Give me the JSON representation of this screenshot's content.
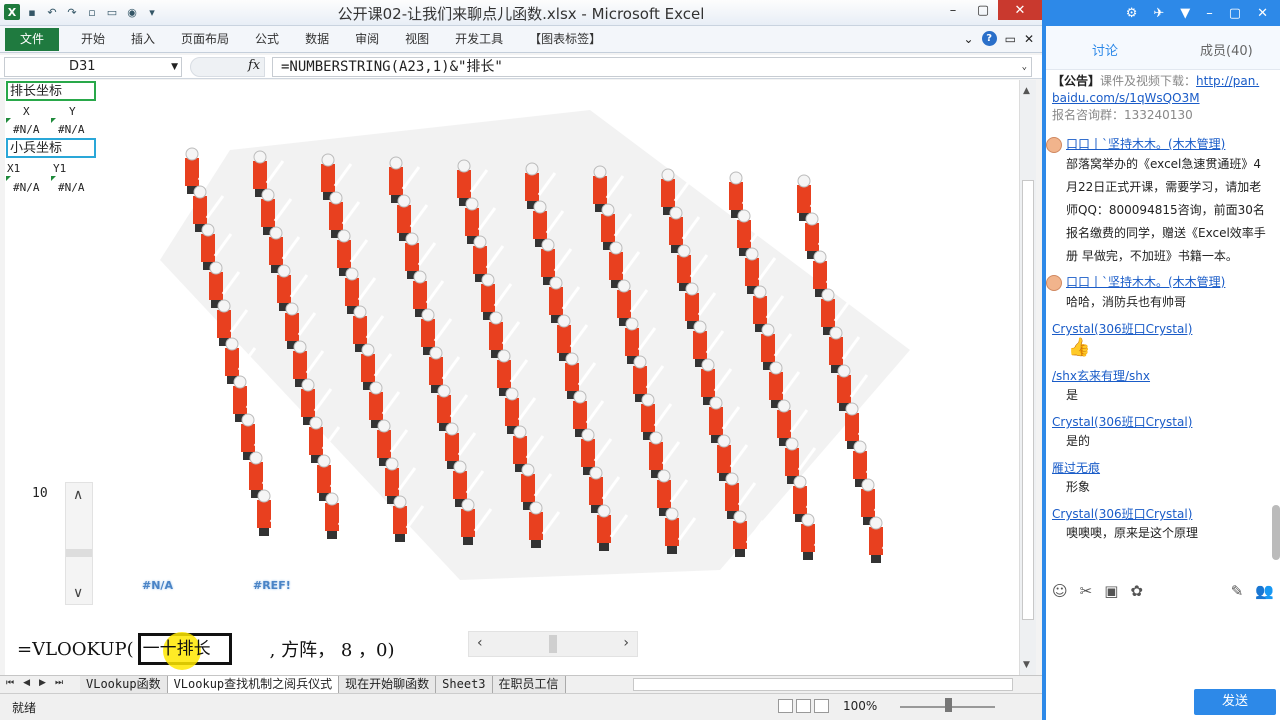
{
  "excel": {
    "window_title": "公开课02-让我们来聊点儿函数.xlsx - Microsoft Excel",
    "file_tab": "文件",
    "ribbon_tabs": [
      "开始",
      "插入",
      "页面布局",
      "公式",
      "数据",
      "审阅",
      "视图",
      "开发工具",
      "【图表标签】"
    ],
    "name_box": "D31",
    "fx": "fx",
    "formula": "=NUMBERSTRING(A23,1)&\"排长\"",
    "cells": {
      "pl_label": "排长坐标",
      "x_hdr": "X",
      "y_hdr": "Y",
      "na1": "#N/A",
      "na2": "#N/A",
      "soldier_label": "小兵坐标",
      "x1_hdr": "X1",
      "y1_hdr": "Y1",
      "na3": "#N/A",
      "na4": "#N/A"
    },
    "spinner_value": "10",
    "chart_na": "#N/A",
    "chart_ref": "#REF!",
    "vlookup": {
      "prefix": "=VLOOKUP(",
      "lookup_value": "一十排长",
      "rest": ", 方阵， 8 ，0)"
    },
    "sheet_tabs": [
      "VLookup函数",
      "VLookup查找机制之阅兵仪式",
      "现在开始聊函数",
      "Sheet3",
      "在职员工信"
    ],
    "active_sheet": "VLookup查找机制之阅兵仪式",
    "status_ready": "就绪",
    "zoom": "100%"
  },
  "chat": {
    "tab_discuss": "讨论",
    "tab_members": "成员(40)",
    "notice_head": "【公告】",
    "notice_text": "课件及视频下载：",
    "notice_link1": "http://pan.",
    "notice_link2": "baidu.com/s/1qWsQO3M",
    "notice_group": "报名咨询群：133240130",
    "messages": [
      {
        "user": "口口丨`坚持木木。(木木管理)",
        "text": "部落窝举办的《excel急速贯通班》4月22日正式开课，需要学习，请加老师QQ：800094815咨询，前面30名报名缴费的同学，赠送《Excel效率手册 早做完，不加班》书籍一本。"
      },
      {
        "user": "口口丨`坚持木木。(木木管理)",
        "text": "哈哈，消防兵也有帅哥"
      },
      {
        "user": "Crystal(306班口Crystal)",
        "text": "👍"
      },
      {
        "user": "/shx玄来有理/shx",
        "text": "是"
      },
      {
        "user": "Crystal(306班口Crystal)",
        "text": "是的"
      },
      {
        "user": "雁过无痕",
        "text": "形象"
      },
      {
        "user": "Crystal(306班口Crystal)",
        "text": "噢噢噢，原来是这个原理"
      }
    ],
    "send_label": "发送"
  }
}
